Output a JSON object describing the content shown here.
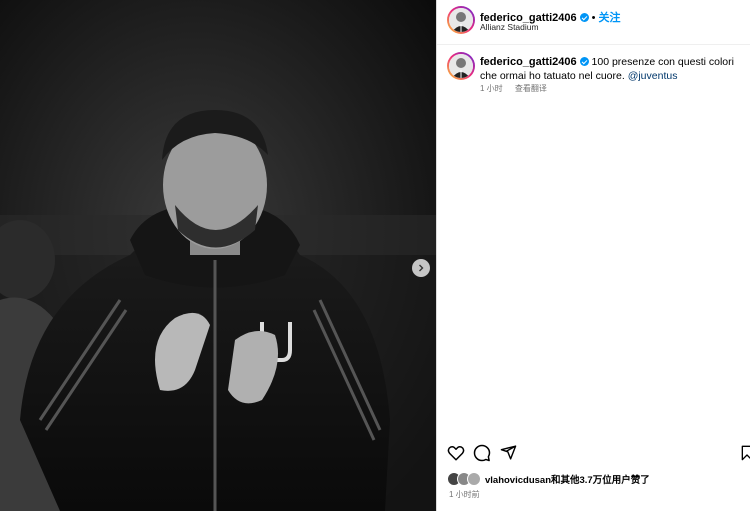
{
  "post": {
    "username": "federico_gatti2406",
    "follow_label": "关注",
    "separator": "•",
    "location": "Allianz Stadium",
    "caption_text": "100 presenze con questi colori che ormai ho tatuato nel cuore.",
    "caption_mention": "@juventus",
    "caption_time": "1 小时",
    "see_translation": "查看翻译",
    "likes_text": "vlahovicdusan和其他3.7万位用户赞了",
    "time_ago": "1 小时前"
  },
  "icons": {
    "verified": "verified-badge-icon",
    "like": "heart-icon",
    "comment": "comment-icon",
    "share": "paper-plane-icon",
    "save": "bookmark-icon",
    "next": "chevron-right-icon"
  },
  "colors": {
    "accent": "#0095f6",
    "mention": "#00376b",
    "muted": "#737373"
  }
}
